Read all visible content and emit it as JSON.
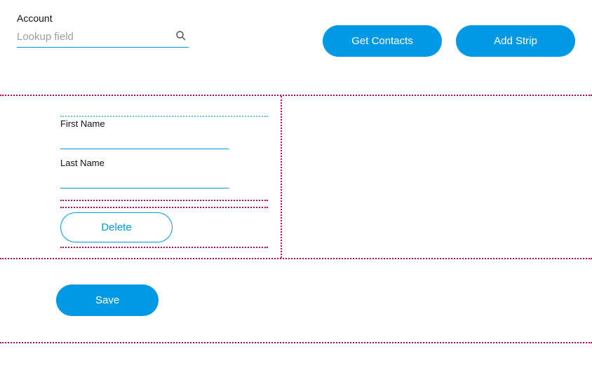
{
  "lookup": {
    "label": "Account",
    "placeholder": "Lookup field",
    "value": ""
  },
  "buttons": {
    "get_contacts": "Get Contacts",
    "add_strip": "Add Strip",
    "delete": "Delete",
    "save": "Save"
  },
  "form": {
    "first_name": {
      "label": "First Name",
      "value": ""
    },
    "last_name": {
      "label": "Last Name",
      "value": ""
    }
  },
  "colors": {
    "accent": "#0099e5",
    "guide_magenta": "#c3006b",
    "guide_cyan": "#5ec9f0"
  }
}
